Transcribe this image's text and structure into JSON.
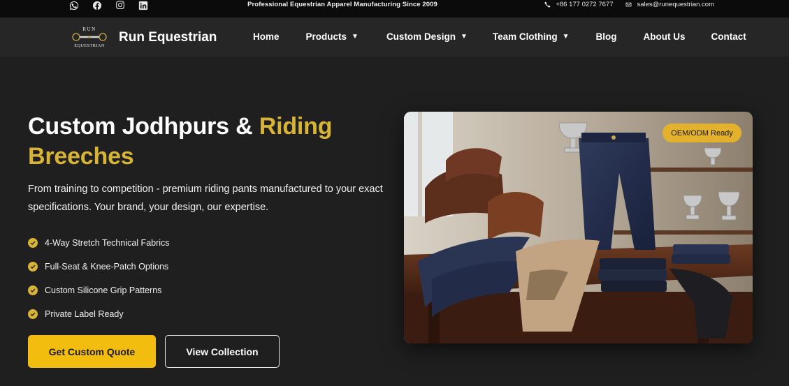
{
  "topbar": {
    "social": [
      "whatsapp-icon",
      "facebook-icon",
      "instagram-icon",
      "linkedin-icon"
    ],
    "tagline": "Professional Equestrian Apparel Manufacturing Since 2009",
    "phone": "+86 177 0272 7677",
    "email": "sales@runequestrian.com"
  },
  "nav": {
    "logo_top": "RUN",
    "logo_bottom": "EQUESTRIAN",
    "brand": "Run Equestrian",
    "items": [
      {
        "label": "Home",
        "dropdown": false
      },
      {
        "label": "Products",
        "dropdown": true
      },
      {
        "label": "Custom Design",
        "dropdown": true
      },
      {
        "label": "Team Clothing",
        "dropdown": true
      },
      {
        "label": "Blog",
        "dropdown": false
      },
      {
        "label": "About Us",
        "dropdown": false
      },
      {
        "label": "Contact",
        "dropdown": false
      }
    ],
    "caret": "▼"
  },
  "hero": {
    "title_part1": "Custom Jodhpurs & ",
    "title_highlight": "Riding Breeches",
    "subtitle": "From training to competition - premium riding pants manufactured to your exact specifications. Your brand, your design, our expertise.",
    "features": [
      "4-Way Stretch Technical Fabrics",
      "Full-Seat & Knee-Patch Options",
      "Custom Silicone Grip Patterns",
      "Private Label Ready"
    ],
    "primary_button": "Get Custom Quote",
    "secondary_button": "View Collection",
    "badge": "OEM/ODM Ready"
  },
  "colors": {
    "accent": "#d8b436",
    "button": "#f3bd10",
    "background": "#1f1f1f",
    "nav": "#262626",
    "topbar": "#0b0b0b"
  }
}
